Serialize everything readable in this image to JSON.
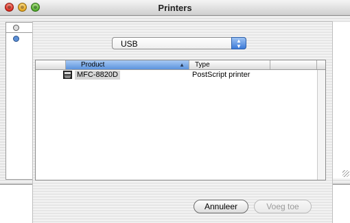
{
  "window": {
    "title": "Printers"
  },
  "sheet": {
    "connection_popup": {
      "selected": "USB"
    },
    "table": {
      "columns": [
        "Product",
        "Type"
      ],
      "sort_column": "Product",
      "rows": [
        {
          "product": "MFC-8820D",
          "type": "PostScript printer"
        }
      ]
    },
    "buttons": {
      "cancel_label": "Annuleer",
      "add_label": "Voeg toe"
    }
  },
  "colors": {
    "accent": "#5b93dd",
    "popup_arrow": "#3b7ad8"
  }
}
